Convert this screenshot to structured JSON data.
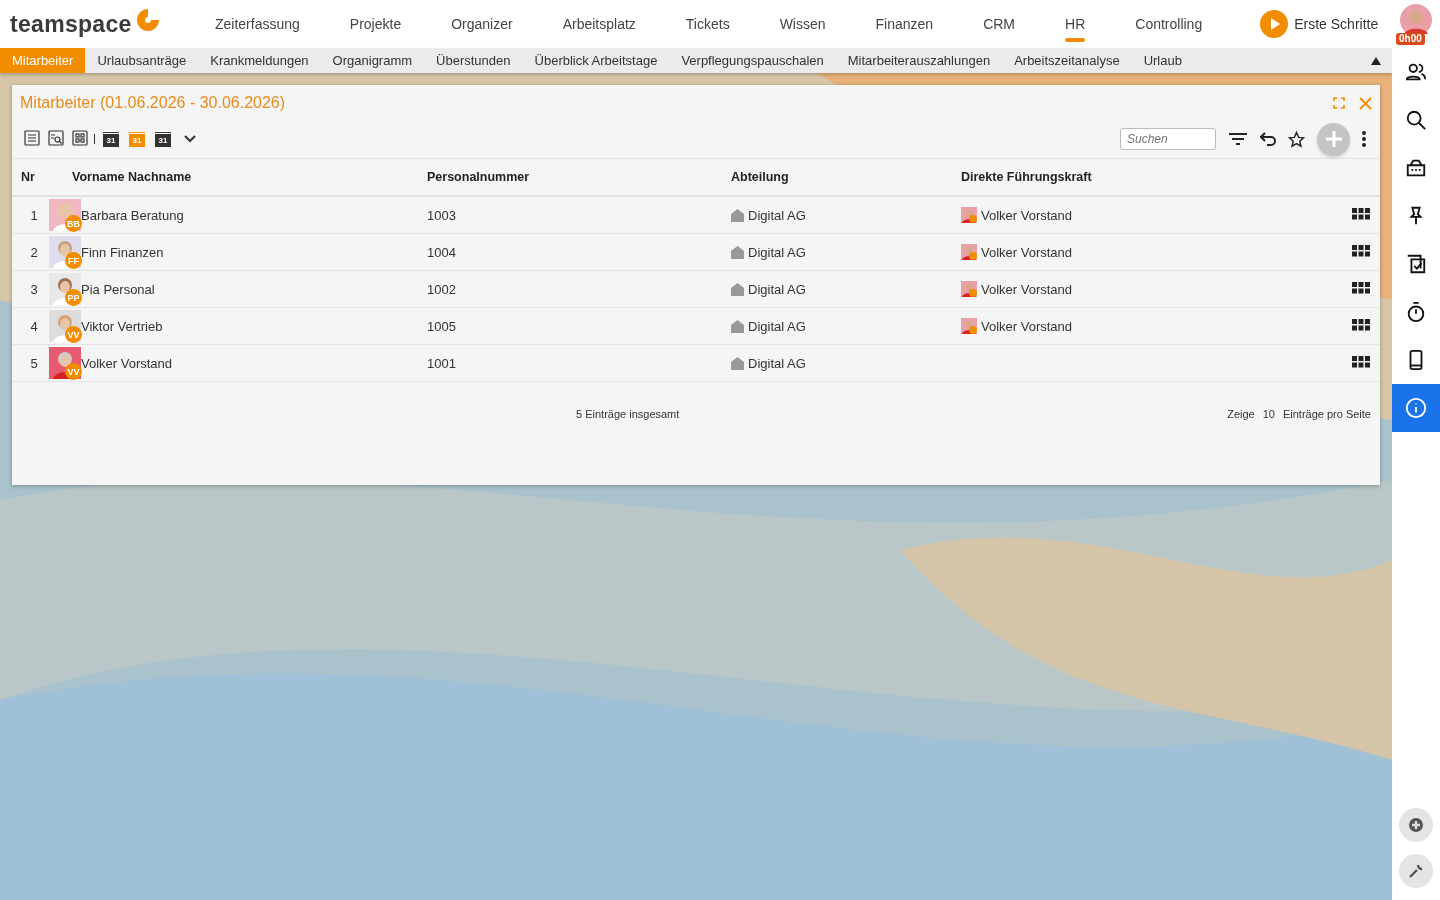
{
  "brand": {
    "name": "teamspace"
  },
  "main_nav": [
    {
      "label": "Zeiterfassung",
      "selected": false
    },
    {
      "label": "Projekte",
      "selected": false
    },
    {
      "label": "Organizer",
      "selected": false
    },
    {
      "label": "Arbeitsplatz",
      "selected": false
    },
    {
      "label": "Tickets",
      "selected": false
    },
    {
      "label": "Wissen",
      "selected": false
    },
    {
      "label": "Finanzen",
      "selected": false
    },
    {
      "label": "CRM",
      "selected": false
    },
    {
      "label": "HR",
      "selected": true
    },
    {
      "label": "Controlling",
      "selected": false
    }
  ],
  "first_steps": {
    "label": "Erste Schritte"
  },
  "user": {
    "timer": "0h00"
  },
  "sub_nav": [
    {
      "label": "Mitarbeiter",
      "selected": true
    },
    {
      "label": "Urlaubsanträge",
      "selected": false
    },
    {
      "label": "Krankmeldungen",
      "selected": false
    },
    {
      "label": "Organigramm",
      "selected": false
    },
    {
      "label": "Überstunden",
      "selected": false
    },
    {
      "label": "Überblick Arbeitstage",
      "selected": false
    },
    {
      "label": "Verpflegungspauschalen",
      "selected": false
    },
    {
      "label": "Mitarbeiterauszahlungen",
      "selected": false
    },
    {
      "label": "Arbeitszeitanalyse",
      "selected": false
    },
    {
      "label": "Urlaub",
      "selected": false
    }
  ],
  "panel": {
    "title": "Mitarbeiter (01.06.2026 - 30.06.2026)",
    "views": [
      {
        "kind": "list",
        "selected": false
      },
      {
        "kind": "search",
        "selected": false
      },
      {
        "kind": "grid",
        "selected": false
      },
      {
        "kind": "calendar",
        "label": "31",
        "selected": false
      },
      {
        "kind": "calendar",
        "label": "31",
        "selected": true
      },
      {
        "kind": "calendar",
        "label": "31",
        "selected": false
      }
    ],
    "search": {
      "placeholder": "Suchen"
    },
    "table": {
      "columns": [
        "Nr",
        "Vorname Nachname",
        "Personalnummer",
        "Abteilung",
        "Direkte Führungskraft"
      ],
      "rows": [
        {
          "nr": "1",
          "name": "Barbara Beratung",
          "initials": "BB",
          "number": "1003",
          "department": "Digital AG",
          "manager": "Volker Vorstand"
        },
        {
          "nr": "2",
          "name": "Finn Finanzen",
          "initials": "FF",
          "number": "1004",
          "department": "Digital AG",
          "manager": "Volker Vorstand"
        },
        {
          "nr": "3",
          "name": "Pia Personal",
          "initials": "PP",
          "number": "1002",
          "department": "Digital AG",
          "manager": "Volker Vorstand"
        },
        {
          "nr": "4",
          "name": "Viktor Vertrieb",
          "initials": "VV",
          "number": "1005",
          "department": "Digital AG",
          "manager": "Volker Vorstand"
        },
        {
          "nr": "5",
          "name": "Volker Vorstand",
          "initials": "VV",
          "number": "1001",
          "department": "Digital AG"
        }
      ]
    },
    "total": "5 Einträge insgesamt",
    "page_size": {
      "prefix": "Zeige",
      "value": "10",
      "suffix": "Einträge pro Seite"
    }
  },
  "sidebar": [
    {
      "kind": "people",
      "selected": false
    },
    {
      "kind": "search",
      "selected": false
    },
    {
      "kind": "inbox",
      "selected": false
    },
    {
      "kind": "pin",
      "selected": false
    },
    {
      "kind": "tasks",
      "selected": false
    },
    {
      "kind": "timer",
      "selected": false
    },
    {
      "kind": "phone",
      "selected": false
    },
    {
      "kind": "info",
      "selected": true
    }
  ],
  "sidebar_bottom": [
    {
      "kind": "add"
    },
    {
      "kind": "wrench"
    }
  ]
}
